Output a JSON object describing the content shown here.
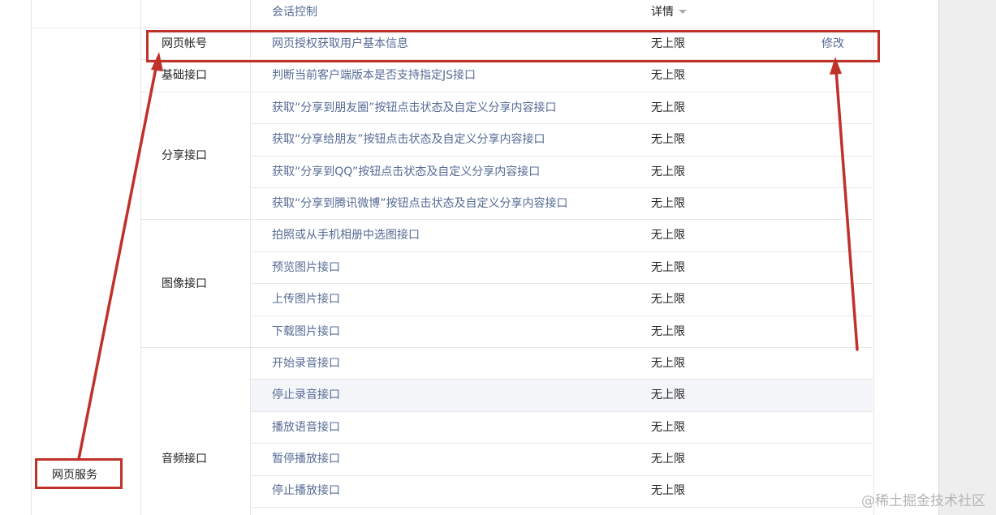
{
  "header": {
    "api": "会话控制",
    "details": "详情"
  },
  "groups": {
    "web_service": "网页服务"
  },
  "categories": {
    "web_account": "网页帐号",
    "basic_api": "基础接口",
    "share_api": "分享接口",
    "image_api": "图像接口",
    "audio_api": "音频接口"
  },
  "rows": [
    {
      "api": "网页授权获取用户基本信息",
      "quota": "无上限",
      "action": "修改"
    },
    {
      "api": "判断当前客户端版本是否支持指定JS接口",
      "quota": "无上限"
    },
    {
      "api": "获取“分享到朋友圈”按钮点击状态及自定义分享内容接口",
      "quota": "无上限"
    },
    {
      "api": "获取“分享给朋友”按钮点击状态及自定义分享内容接口",
      "quota": "无上限"
    },
    {
      "api": "获取“分享到QQ”按钮点击状态及自定义分享内容接口",
      "quota": "无上限"
    },
    {
      "api": "获取“分享到腾讯微博”按钮点击状态及自定义分享内容接口",
      "quota": "无上限"
    },
    {
      "api": "拍照或从手机相册中选图接口",
      "quota": "无上限"
    },
    {
      "api": "预览图片接口",
      "quota": "无上限"
    },
    {
      "api": "上传图片接口",
      "quota": "无上限"
    },
    {
      "api": "下载图片接口",
      "quota": "无上限"
    },
    {
      "api": "开始录音接口",
      "quota": "无上限"
    },
    {
      "api": "停止录音接口",
      "quota": "无上限"
    },
    {
      "api": "播放语音接口",
      "quota": "无上限"
    },
    {
      "api": "暂停播放接口",
      "quota": "无上限"
    },
    {
      "api": "停止播放接口",
      "quota": "无上限"
    }
  ],
  "colors": {
    "link": "#576b95",
    "annotation_red": "#c0312a",
    "hover_row": "#f4f5f9"
  },
  "watermark": "@稀土掘金技术社区"
}
